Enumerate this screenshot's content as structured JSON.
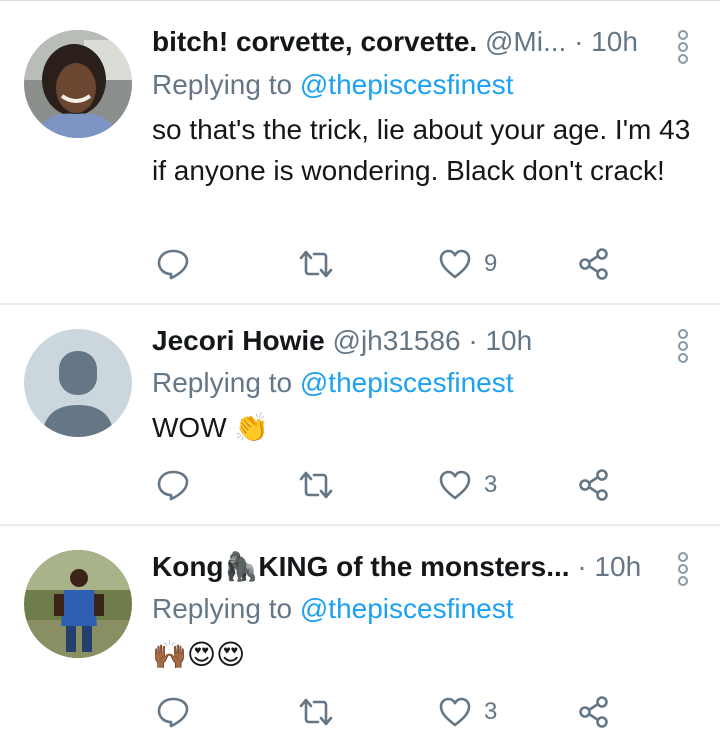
{
  "tweets": [
    {
      "name": "bitch! corvette, corvette.",
      "handle": "@Mi...",
      "time": "· 10h",
      "reply_prefix": "Replying to ",
      "reply_to": "@thepiscesfinest",
      "text": "so that's the trick, lie about your age. I'm 43 if anyone is wondering. Black don't crack!",
      "likes": "9",
      "avatar": "photo"
    },
    {
      "name": "Jecori Howie",
      "handle": "@jh31586",
      "time": "· 10h",
      "reply_prefix": "Replying to ",
      "reply_to": "@thepiscesfinest",
      "text": "WOW 👏",
      "likes": "3",
      "avatar": "default-profile"
    },
    {
      "name": "Kong🦍KING of the monsters...",
      "handle": "",
      "time": "· 10h",
      "reply_prefix": "Replying to ",
      "reply_to": "@thepiscesfinest",
      "text": "🙌🏾😍😍",
      "likes": "3",
      "avatar": "photo"
    }
  ],
  "icons": {
    "reply": "reply-icon",
    "retweet": "retweet-icon",
    "like": "heart-icon",
    "share": "share-icon",
    "more": "more-vertical-icon"
  },
  "colors": {
    "link": "#1da1f2",
    "secondary": "#657786",
    "text": "#14171a",
    "divider": "#e6ecf0"
  }
}
